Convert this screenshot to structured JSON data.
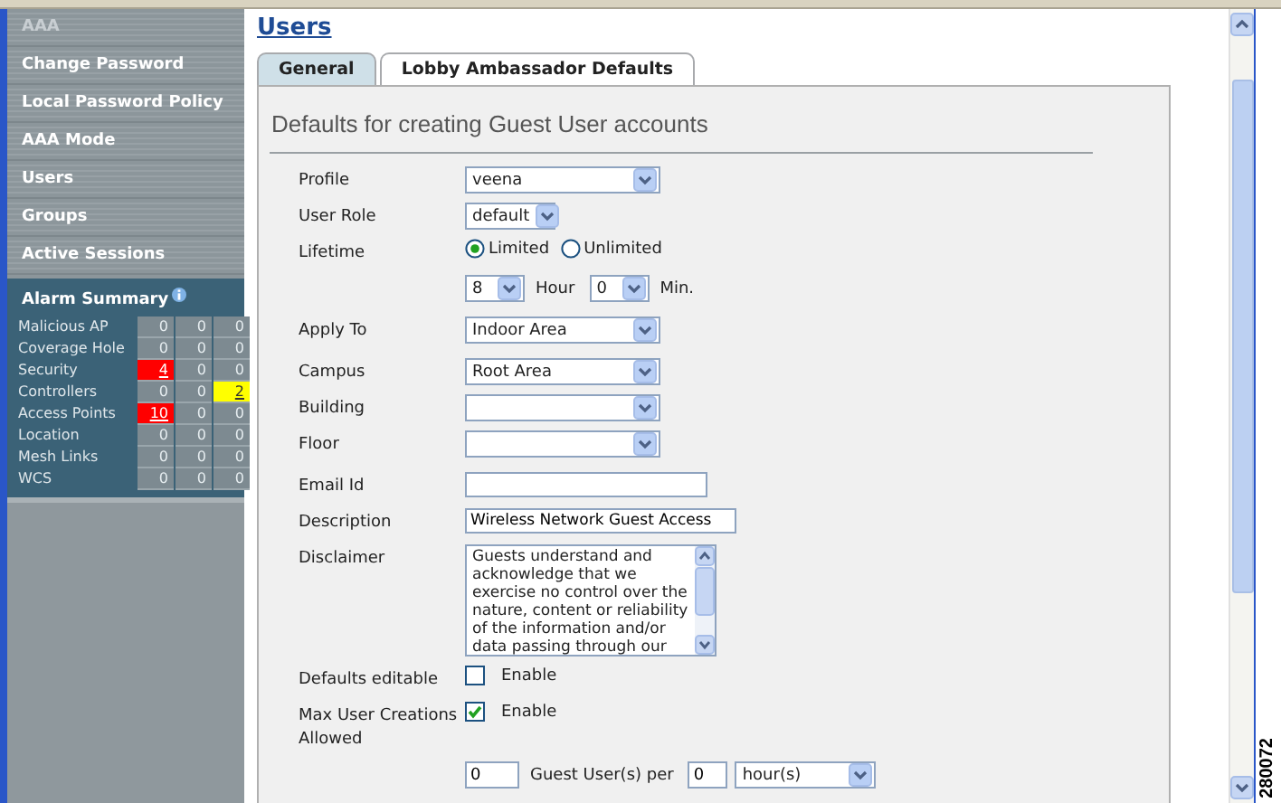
{
  "sidebar": {
    "items": [
      {
        "label": "AAA",
        "kind": "header"
      },
      {
        "label": "Change Password",
        "kind": "link"
      },
      {
        "label": "Local Password Policy",
        "kind": "link"
      },
      {
        "label": "AAA Mode",
        "kind": "link"
      },
      {
        "label": "Users",
        "kind": "link"
      },
      {
        "label": "Groups",
        "kind": "link"
      },
      {
        "label": "Active Sessions",
        "kind": "link"
      }
    ]
  },
  "alarm_summary": {
    "title": "Alarm Summary",
    "rows": [
      {
        "label": "Malicious AP",
        "counts": [
          {
            "value": "0",
            "color": "#7d8a91"
          },
          {
            "value": "0",
            "color": "#7d8a91"
          },
          {
            "value": "0",
            "color": "#7d8a91"
          }
        ]
      },
      {
        "label": "Coverage Hole",
        "counts": [
          {
            "value": "0",
            "color": "#7d8a91"
          },
          {
            "value": "0",
            "color": "#7d8a91"
          },
          {
            "value": "0",
            "color": "#7d8a91"
          }
        ]
      },
      {
        "label": "Security",
        "counts": [
          {
            "value": "4",
            "color": "#ff0000"
          },
          {
            "value": "0",
            "color": "#7d8a91"
          },
          {
            "value": "0",
            "color": "#7d8a91"
          }
        ]
      },
      {
        "label": "Controllers",
        "counts": [
          {
            "value": "0",
            "color": "#7d8a91"
          },
          {
            "value": "0",
            "color": "#7d8a91"
          },
          {
            "value": "2",
            "color": "#ffff00"
          }
        ]
      },
      {
        "label": "Access Points",
        "counts": [
          {
            "value": "10",
            "color": "#ff0000"
          },
          {
            "value": "0",
            "color": "#7d8a91"
          },
          {
            "value": "0",
            "color": "#7d8a91"
          }
        ]
      },
      {
        "label": "Location",
        "counts": [
          {
            "value": "0",
            "color": "#7d8a91"
          },
          {
            "value": "0",
            "color": "#7d8a91"
          },
          {
            "value": "0",
            "color": "#7d8a91"
          }
        ]
      },
      {
        "label": "Mesh Links",
        "counts": [
          {
            "value": "0",
            "color": "#7d8a91"
          },
          {
            "value": "0",
            "color": "#7d8a91"
          },
          {
            "value": "0",
            "color": "#7d8a91"
          }
        ]
      },
      {
        "label": "WCS",
        "counts": [
          {
            "value": "0",
            "color": "#7d8a91"
          },
          {
            "value": "0",
            "color": "#7d8a91"
          },
          {
            "value": "0",
            "color": "#7d8a91"
          }
        ]
      }
    ]
  },
  "page": {
    "title": "Users",
    "tabs": [
      {
        "label": "General",
        "selected": false
      },
      {
        "label": "Lobby Ambassador Defaults",
        "selected": true
      }
    ],
    "section_title": "Defaults for creating Guest User accounts",
    "field_groups": [
      [
        {
          "kind": "select",
          "label": "Profile",
          "value": "veena"
        },
        {
          "kind": "compact-select",
          "label": "User Role",
          "value": "default"
        },
        {
          "kind": "radio",
          "label": "Lifetime",
          "options": [
            {
              "label": "Limited",
              "selected": true
            },
            {
              "label": "Unlimited",
              "selected": false
            }
          ]
        },
        {
          "kind": "duration",
          "hours": "8",
          "hours_unit": "Hour",
          "minutes": "0",
          "minutes_unit": "Min."
        }
      ],
      [
        {
          "kind": "select",
          "label": "Apply To",
          "value": "Indoor Area"
        }
      ],
      [
        {
          "kind": "select",
          "label": "Campus",
          "value": "Root Area"
        },
        {
          "kind": "select",
          "label": "Building"
        },
        {
          "kind": "select",
          "label": "Floor"
        }
      ],
      [
        {
          "kind": "text",
          "label": "Email Id"
        },
        {
          "kind": "text",
          "label": "Description",
          "value": "Wireless Network Guest Access"
        },
        {
          "kind": "textarea",
          "label": "Disclaimer",
          "value": "Guests understand and acknowledge that we exercise no control over the nature, content or reliability of the information and/or data passing through our"
        },
        {
          "kind": "checkbox",
          "label": "Defaults editable",
          "option": "Enable",
          "checked": false
        },
        {
          "kind": "checkbox",
          "label": "Max User Creations Allowed",
          "option": "Enable",
          "checked": true
        },
        {
          "kind": "rate",
          "count": "0",
          "text": "Guest User(s) per",
          "period_count": "0",
          "period_unit": "hour(s)"
        }
      ]
    ]
  },
  "figure_number": "280072"
}
